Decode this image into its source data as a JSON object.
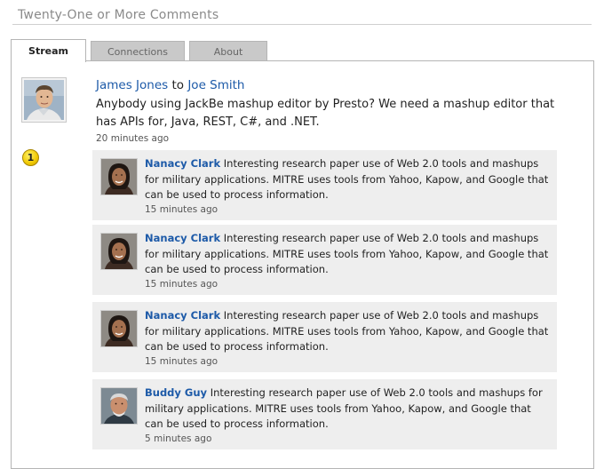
{
  "page": {
    "title": "Twenty-One or More Comments"
  },
  "tabs": [
    {
      "label": "Stream",
      "active": true
    },
    {
      "label": "Connections",
      "active": false
    },
    {
      "label": "About",
      "active": false
    }
  ],
  "post": {
    "author": "James Jones",
    "connector": "to",
    "recipient": "Joe Smith",
    "text": "Anybody using JackBe mashup editor by Presto? We need a mashup editor that has APIs for, Java, REST, C#, and .NET.",
    "time": "20 minutes ago",
    "badge": "1"
  },
  "comments": [
    {
      "author": "Nanacy Clark",
      "text": "Interesting research paper use of Web 2.0 tools and mashups for military applications. MITRE uses tools from Yahoo, Kapow, and Google that can be used to process information.",
      "time": "15 minutes ago"
    },
    {
      "author": "Nanacy Clark",
      "text": "Interesting research paper use of Web 2.0 tools and mashups for military applications. MITRE uses tools from Yahoo, Kapow, and Google that can be used to process information.",
      "time": "15 minutes ago"
    },
    {
      "author": "Nanacy Clark",
      "text": "Interesting research paper use of Web 2.0 tools and mashups for military applications. MITRE uses tools from Yahoo, Kapow, and Google that can be used to process information.",
      "time": "15 minutes ago"
    },
    {
      "author": "Buddy Guy",
      "text": "Interesting research paper use of Web 2.0 tools and mashups for military applications. MITRE uses tools from Yahoo, Kapow, and Google that can be used to process information.",
      "time": "5 minutes ago"
    }
  ],
  "colors": {
    "link": "#1d5aa8",
    "comment_bg": "#eeeeee",
    "tab_inactive": "#c9c9c9",
    "badge": "#f0c800"
  }
}
